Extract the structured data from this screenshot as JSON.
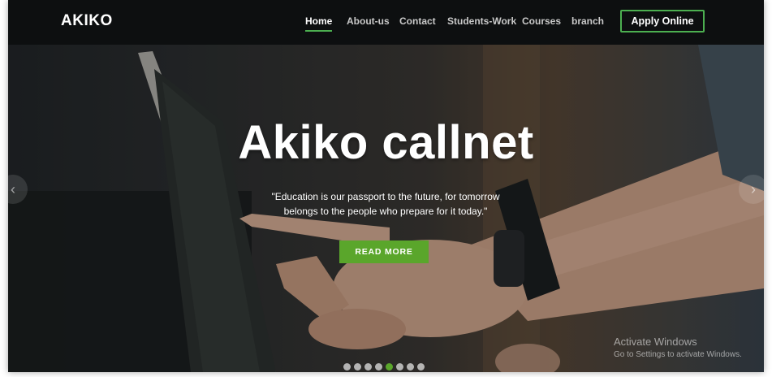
{
  "header": {
    "brand": "AKIKO",
    "nav": [
      {
        "label": "Home",
        "active": true
      },
      {
        "label": "About-us"
      },
      {
        "label": "Contact"
      },
      {
        "label": "Students-Work"
      },
      {
        "label": "Courses"
      },
      {
        "label": "branch"
      }
    ],
    "apply_label": "Apply Online"
  },
  "hero": {
    "title": "Akiko callnet",
    "quote_line1": "\"Education is our passport to the future, for tomorrow",
    "quote_line2": "belongs to the people who prepare for it today.\"",
    "button_label": "READ MORE",
    "slide_count": 8,
    "active_slide": 4,
    "arrow_left": "‹",
    "arrow_right": "›"
  },
  "watermark": {
    "title": "Activate Windows",
    "subtitle": "Go to Settings to activate Windows."
  },
  "colors": {
    "accent": "#4caf50",
    "button_green": "#5aa62b",
    "navbar_bg": "#0d0f10"
  }
}
